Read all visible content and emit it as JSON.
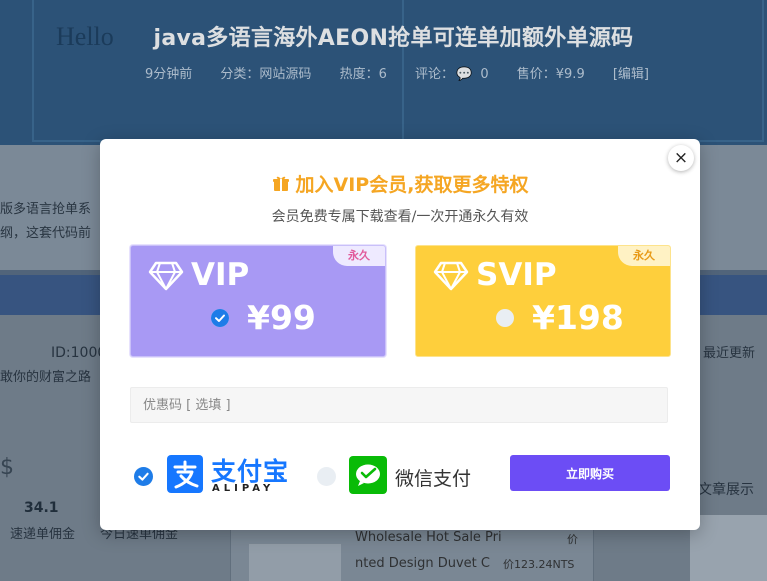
{
  "background": {
    "hello": "Hello",
    "title": "java多语言海外AEON抢单可连单加额外单源码",
    "meta": [
      "9分钟前",
      "分类：网站源码",
      "热度：6",
      "评论：",
      "0",
      "售价：¥9.9",
      "[编辑]"
    ],
    "desc_line1": "版多语言抢单系",
    "desc_line2": "纲，这套代码前",
    "id_text": "ID:1000",
    "wealth_text": "敢你的财富之路",
    "dollar": "$",
    "stat_value": "34.1",
    "stat_label1": "速递单佣金",
    "stat_label2": "今日速单佣金",
    "recent_update": "最近更新",
    "article_show": "文章展示",
    "product_line1": "Wholesale Hot Sale Pri",
    "product_line2": "nted Design Duvet C",
    "product_price": "价123.24NTS",
    "product_side": "价"
  },
  "modal": {
    "title": "加入VIP会员,获取更多特权",
    "subtitle": "会员免费专属下载查看/一次开通永久有效",
    "plans": [
      {
        "name": "VIP",
        "price": "¥99",
        "badge": "永久",
        "selected": true,
        "color": "#a899f4"
      },
      {
        "name": "SVIP",
        "price": "¥198",
        "badge": "永久",
        "selected": false,
        "color": "#fecf3c"
      }
    ],
    "coupon_placeholder": "优惠码 [ 选填 ]",
    "payment": {
      "alipay_cn": "支付宝",
      "alipay_en": "ALIPAY",
      "alipay_selected": true,
      "wechat_label": "微信支付",
      "wechat_selected": false
    },
    "buy_label": "立即购买",
    "close_label": "×"
  },
  "colors": {
    "accent": "#6c4df5",
    "title": "#f5a623",
    "check": "#1e7ce8"
  }
}
